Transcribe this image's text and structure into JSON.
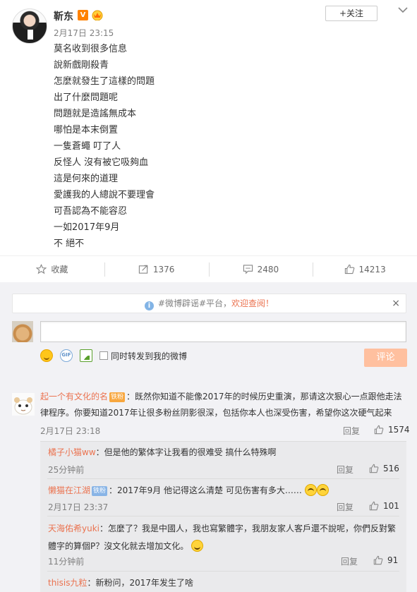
{
  "post": {
    "author": "靳东",
    "verified_badge": "V",
    "time": "2月17日 23:15",
    "follow_label": "+关注",
    "lines": [
      "莫名收到很多信息",
      "說新戲剛殺青",
      "怎麼就發生了這樣的問題",
      "出了什麼問題呢",
      "問題就是造謠無成本",
      "哪怕是本末倒置",
      "一隻蒼蠅 叮了人",
      "反怪人 沒有被它吸夠血",
      "這是何來的道理",
      "愛護我的人總說不要理會",
      "可吾認為不能容忍",
      "一如2017年9月",
      "不 絕不"
    ]
  },
  "actions": {
    "favorite": "收藏",
    "forward": "1376",
    "comment": "2480",
    "like": "14213"
  },
  "comments_area": {
    "notice_prefix": "#微博辟谣#平台，",
    "notice_link": "欢迎查阅！",
    "close": "×",
    "forward_checkbox_label": "同时转发到我的微博",
    "submit_label": "评论"
  },
  "comments": [
    {
      "user": "起一个有文化的名",
      "badge": "铁粉",
      "text": "：既然你知道不能像2017年的时候历史重演，那请这次狠心一点跟他走法律程序。你要知道2017年让很多粉丝阴影很深，包括你本人也深受伤害，希望你这次硬气起来",
      "time": "2月17日 23:18",
      "reply": "回复",
      "likes": "1574"
    }
  ],
  "replies": [
    {
      "user": "橘子小猫ww",
      "text": "：但是他的繁体字让我看的很难受 搞什么特殊啊",
      "time": "25分钟前",
      "reply": "回复",
      "likes": "516"
    },
    {
      "user": "懒猫在江湖",
      "badge": "铁粉",
      "text": "：2017年9月 他记得这么清楚 可见伤害有多大……",
      "time": "2月17日 23:37",
      "reply": "回复",
      "likes": "101"
    },
    {
      "user": "天海佑希yuki",
      "text": "：怎麼了？我是中國人，我也寫繁體字，我朋友家人客戶還不說呢，你們反對繁體字的算個P？沒文化就去增加文化。",
      "time": "11分钟前",
      "reply": "回复",
      "likes": "91"
    },
    {
      "user": "thisis九粒",
      "text": "：新粉问，2017年发生了啥"
    }
  ]
}
